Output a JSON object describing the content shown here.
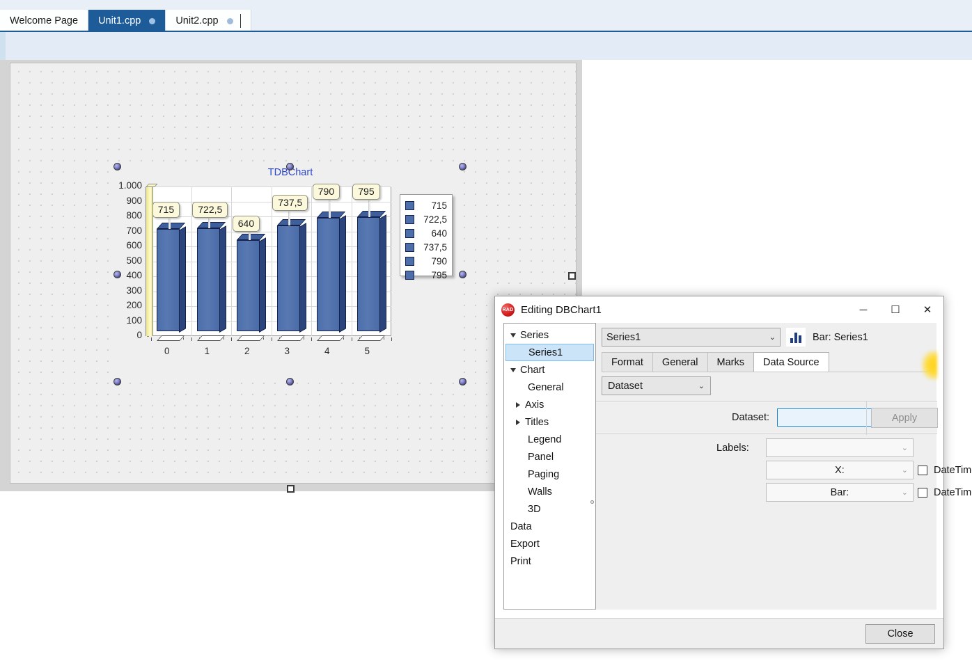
{
  "ide": {
    "tabs": [
      {
        "label": "Welcome Page",
        "active": false,
        "dot": false,
        "caret": false
      },
      {
        "label": "Unit1.cpp",
        "active": true,
        "dot": true,
        "caret": false
      },
      {
        "label": "Unit2.cpp",
        "active": false,
        "dot": true,
        "caret": true
      }
    ]
  },
  "chart_data": {
    "type": "bar",
    "title": "TDBChart",
    "categories": [
      "0",
      "1",
      "2",
      "3",
      "4",
      "5"
    ],
    "values": [
      715,
      722.5,
      640,
      737.5,
      790,
      795
    ],
    "point_labels": [
      "715",
      "722,5",
      "640",
      "737,5",
      "790",
      "795"
    ],
    "legend_entries": [
      "715",
      "722,5",
      "640",
      "737,5",
      "790",
      "795"
    ],
    "legend_position": "right",
    "series_name": "Series1",
    "xlabel": "",
    "ylabel": "",
    "ylim": [
      0,
      1000
    ],
    "ytick_labels": [
      "1.000",
      "900",
      "800",
      "700",
      "600",
      "500",
      "400",
      "300",
      "200",
      "100",
      "0"
    ],
    "ytick_values": [
      1000,
      900,
      800,
      700,
      600,
      500,
      400,
      300,
      200,
      100,
      0
    ],
    "grid": true,
    "bar_color": "#4c6fab",
    "bar_border_color": "#15214a",
    "title_color": "#2f49c6",
    "axis_band_color": "#f7f2a8",
    "mark_bg_color": "#fbf8dc"
  },
  "dialog": {
    "title": "Editing DBChart1",
    "icon": "RAD",
    "window_buttons": {
      "minimize": "─",
      "maximize": "☐",
      "close": "✕"
    },
    "tree": [
      {
        "label": "Series",
        "level": 0,
        "expander": "down",
        "selected": false
      },
      {
        "label": "Series1",
        "level": 1,
        "expander": "none",
        "selected": true
      },
      {
        "label": "Chart",
        "level": 0,
        "expander": "down",
        "selected": false
      },
      {
        "label": "General",
        "level": 1,
        "expander": "none",
        "selected": false
      },
      {
        "label": "Axis",
        "level": 1,
        "expander": "right",
        "selected": false
      },
      {
        "label": "Titles",
        "level": 1,
        "expander": "right",
        "selected": false
      },
      {
        "label": "Legend",
        "level": 1,
        "expander": "none",
        "selected": false
      },
      {
        "label": "Panel",
        "level": 1,
        "expander": "none",
        "selected": false
      },
      {
        "label": "Paging",
        "level": 1,
        "expander": "none",
        "selected": false
      },
      {
        "label": "Walls",
        "level": 1,
        "expander": "none",
        "selected": false
      },
      {
        "label": "3D",
        "level": 1,
        "expander": "none",
        "selected": false
      },
      {
        "label": "Data",
        "level": 0,
        "expander": "none",
        "selected": false
      },
      {
        "label": "Export",
        "level": 0,
        "expander": "none",
        "selected": false
      },
      {
        "label": "Print",
        "level": 0,
        "expander": "none",
        "selected": false
      }
    ],
    "series_combo_value": "Series1",
    "series_type_label": "Bar: Series1",
    "tabs": [
      {
        "label": "Format",
        "active": false
      },
      {
        "label": "General",
        "active": false
      },
      {
        "label": "Marks",
        "active": false
      },
      {
        "label": "Data Source",
        "active": true
      }
    ],
    "source_combo_value": "Dataset",
    "dataset_label": "Dataset:",
    "dataset_value": "",
    "apply_label": "Apply",
    "labels_label": "Labels:",
    "labels_value": "",
    "x_field_value": "X:",
    "bar_field_value": "Bar:",
    "datetime_x_label": "DateTime",
    "datetime_bar_label": "DateTime",
    "close_label": "Close",
    "caret_glyph": "⌄"
  }
}
